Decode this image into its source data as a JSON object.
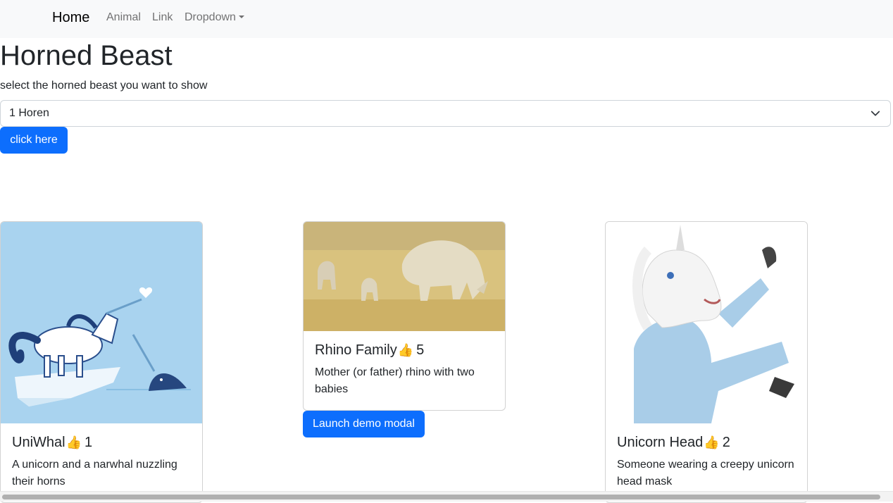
{
  "navbar": {
    "brand": "Home",
    "links": [
      "Animal",
      "Link",
      "Dropdown"
    ]
  },
  "page": {
    "title": "Horned Beast",
    "select_label": "select the horned beast you want to show",
    "select_value": "1 Horen",
    "button_label": "click here"
  },
  "cards": [
    {
      "title": "UniWhal",
      "likes": "1",
      "description": "A unicorn and a narwhal nuzzling their horns"
    },
    {
      "title": "Rhino Family",
      "likes": "5",
      "description": "Mother (or father) rhino with two babies"
    },
    {
      "title": "Unicorn Head",
      "likes": "2",
      "description": "Someone wearing a creepy unicorn head mask"
    }
  ],
  "modal_button": "Launch demo modal",
  "colors": {
    "primary": "#0d6efd",
    "navbar_bg": "#f8f9fa",
    "thumb": "#f5b82e"
  },
  "icons": [
    "thumbs-up-icon",
    "chevron-down-icon",
    "caret-down-icon"
  ]
}
